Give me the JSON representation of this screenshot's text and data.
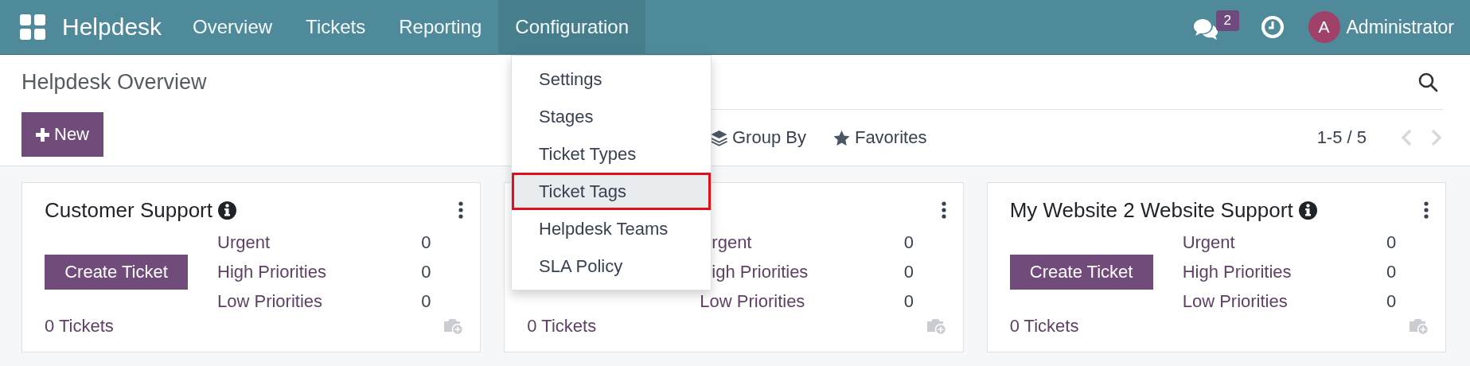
{
  "navbar": {
    "app_name": "Helpdesk",
    "menu": [
      {
        "label": "Overview",
        "selected": false
      },
      {
        "label": "Tickets",
        "selected": false
      },
      {
        "label": "Reporting",
        "selected": false
      },
      {
        "label": "Configuration",
        "selected": true
      }
    ],
    "messages_badge": "2",
    "user": {
      "initial": "A",
      "name": "Administrator"
    }
  },
  "control_panel": {
    "title": "Helpdesk Overview",
    "new_button": "New",
    "search_options": [
      {
        "kind": "group_by",
        "label": "Group By"
      },
      {
        "kind": "favorites",
        "label": "Favorites"
      }
    ],
    "pager": "1-5 / 5"
  },
  "dropdown": {
    "items": [
      {
        "label": "Settings",
        "highlighted": false
      },
      {
        "label": "Stages",
        "highlighted": false
      },
      {
        "label": "Ticket Types",
        "highlighted": false
      },
      {
        "label": "Ticket Tags",
        "highlighted": true
      },
      {
        "label": "Helpdesk Teams",
        "highlighted": false
      },
      {
        "label": "SLA Policy",
        "highlighted": false
      }
    ]
  },
  "cards": [
    {
      "title": "Customer Support",
      "create_button": "Create Ticket",
      "stats": [
        {
          "kind": "full",
          "label": "Urgent",
          "count": "0"
        },
        {
          "kind": "full",
          "label": "High Priorities",
          "count": "0"
        },
        {
          "kind": "full",
          "label": "Low Priorities",
          "count": "0"
        }
      ],
      "tickets_link": "0 Tickets"
    },
    {
      "stats": [
        {
          "kind": "clipped",
          "label": "rgent",
          "count": "0"
        },
        {
          "kind": "clipped",
          "label": "igh Priorities",
          "count": "0"
        },
        {
          "kind": "full",
          "label": "Low Priorities",
          "count": "0"
        }
      ],
      "tickets_link": "0 Tickets"
    },
    {
      "title": "My Website 2 Website Support",
      "create_button": "Create Ticket",
      "stats": [
        {
          "kind": "full",
          "label": "Urgent",
          "count": "0"
        },
        {
          "kind": "full",
          "label": "High Priorities",
          "count": "0"
        },
        {
          "kind": "full",
          "label": "Low Priorities",
          "count": "0"
        }
      ],
      "tickets_link": "0 Tickets"
    }
  ]
}
